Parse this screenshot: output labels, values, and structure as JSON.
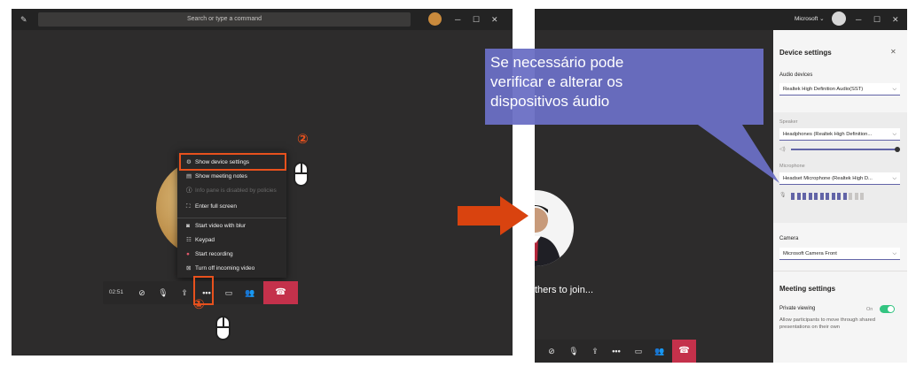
{
  "left": {
    "search_placeholder": "Search or type a command",
    "menu": [
      {
        "label": "Show device settings",
        "icon": "gear-icon"
      },
      {
        "label": "Show meeting notes",
        "icon": "notes-icon"
      },
      {
        "label": "Info pane is disabled by policies",
        "icon": "info-icon",
        "disabled": true
      },
      {
        "label": "Enter full screen",
        "icon": "fullscreen-icon"
      },
      {
        "label": "Start video with blur",
        "icon": "blur-icon"
      },
      {
        "label": "Keypad",
        "icon": "keypad-icon"
      },
      {
        "label": "Start recording",
        "icon": "record-icon"
      },
      {
        "label": "Turn off incoming video",
        "icon": "video-off-icon"
      }
    ],
    "timer": "02:51",
    "marker_1": "①",
    "marker_2": "②"
  },
  "right": {
    "tenant": "Microsoft",
    "join_text": "thers to join...",
    "panel": {
      "title": "Device settings",
      "audio_devices_label": "Audio devices",
      "audio_devices_value": "Realtek High Definition Audio(SST)",
      "speaker_label": "Speaker",
      "speaker_value": "Headphones (Realtek High Definition...",
      "microphone_label": "Microphone",
      "microphone_value": "Headset Microphone (Realtek High D...",
      "camera_label": "Camera",
      "camera_value": "Microsoft Camera Front",
      "meeting_settings_title": "Meeting settings",
      "private_viewing_label": "Private viewing",
      "private_viewing_state": "On",
      "private_viewing_desc": "Allow participants to move through shared presentations on their own",
      "speaker_volume": 1.0,
      "mic_level_bars_active": 10,
      "mic_level_bars_total": 13
    }
  },
  "callout": {
    "text": "Se necessário pode verificar e alterar os dispositivos áudio"
  },
  "colors": {
    "accent": "#6264a7",
    "highlight": "#e8511d",
    "hangup": "#c4314b",
    "callout_bg": "#6a6fc4",
    "arrow": "#d9430f"
  }
}
